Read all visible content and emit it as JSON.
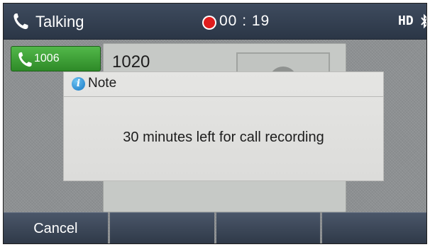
{
  "status_bar": {
    "title": "Talking",
    "timer": "00 : 19",
    "hd_label": "HD",
    "icons": [
      "handset-icon",
      "recording-dot-icon",
      "bluetooth-icon"
    ]
  },
  "line_key": {
    "label": "1006",
    "icon": "handset-icon",
    "color": "#3aa332"
  },
  "call": {
    "number": "1020",
    "avatar_icon": "contact-avatar-icon"
  },
  "dialog": {
    "title": "Note",
    "icon": "info-icon",
    "message": "30 minutes left for call recording"
  },
  "softkeys": [
    "Cancel",
    "",
    "",
    ""
  ],
  "colors": {
    "recording": "#e01d1d",
    "status_bar": "#344051",
    "softkey": "#3b4657"
  }
}
